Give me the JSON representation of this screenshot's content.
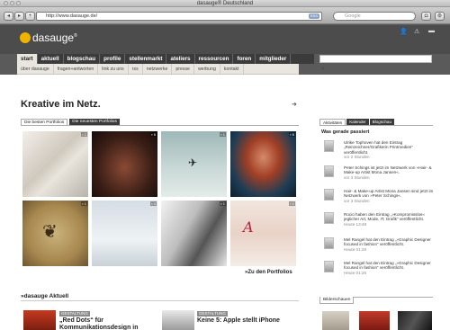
{
  "window": {
    "title": "dasauge® Deutschland"
  },
  "browser": {
    "url": "http://www.dasauge.de/",
    "rss_label": "RSS",
    "search_placeholder": "Google"
  },
  "site": {
    "logo_text": "dasauge",
    "logo_reg": "®"
  },
  "main_nav": [
    "start",
    "aktuell",
    "blogschau",
    "profile",
    "stellenmarkt",
    "ateliers",
    "ressourcen",
    "foren",
    "mitglieder"
  ],
  "sub_nav": [
    "über dasauge",
    "fragen+antworten",
    "link zu uns",
    "rss",
    "netzwerke",
    "presse",
    "werbung",
    "kontakt"
  ],
  "main": {
    "headline": "Kreative im Netz.",
    "tab_best": "Die besten Portfolios",
    "tab_newest": "Die neuesten Portfolios",
    "portfolio_link": "»Zu den Portfolios",
    "aktuell_heading": "»dasauge Aktuell",
    "news": [
      {
        "tag": "GESTALTUNG",
        "title": "„Red Dots“ für Kommunikationsdesign in"
      },
      {
        "tag": "GESTALTUNG",
        "title": "Keine 5: Apple stellt iPhone"
      }
    ]
  },
  "portfolio_badges": [
    "▪ 1",
    "▪ 6",
    "▪ 1",
    "▪ 6",
    "▪ 1",
    "▪ 4",
    "▪ 1",
    "▪ 1"
  ],
  "sidebar": {
    "tabs": [
      "Aktivitäten",
      "Kalender",
      "Blogschau"
    ],
    "heading": "Was gerade passiert",
    "activities": [
      {
        "text": "Ulrike Tophoven hat den Eintrag „Reinzeichner/Grafikerin Printmedien“ veröffentlicht.",
        "time": "vor 2 Stunden"
      },
      {
        "text": "Peter Schings ist jetzt im Netzwerk von »Hair- & Make-up Artist Mona Jansen«.",
        "time": "vor 3 Stunden"
      },
      {
        "text": "Hair- & Make-up Artist Mona Jansen sind jetzt im Netzwerk von »Peter Schings«.",
        "time": "vor 3 Stunden"
      },
      {
        "text": "Rocio haben den Eintrag „»Kompromisslos« jeglicher Art, Mode, IT, Grafik“ veröffentlicht.",
        "time": "Heute 13:48"
      },
      {
        "text": "Mel Rangel hat den Eintrag „»Graphic Designer focused in fashion“ veröffentlicht.",
        "time": "Heute 01:29"
      },
      {
        "text": "Mel Rangel hat den Eintrag „»Graphic Designer focused in fashion“ veröffentlicht.",
        "time": "Heute 01:26"
      }
    ],
    "bilder_tab": "Bilderschauen"
  }
}
